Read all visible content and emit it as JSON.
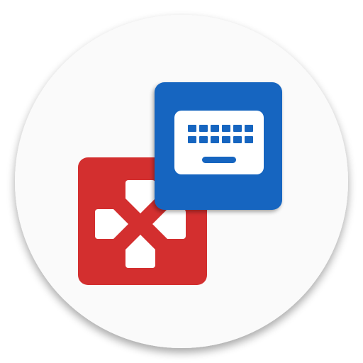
{
  "icon": {
    "name": "gamepad-keyboard-app-icon",
    "background_color": "#fafafa",
    "gamepad_tile_color": "#d32f2f",
    "keyboard_tile_color": "#1565c0",
    "glyph_color": "#ffffff",
    "shapes": [
      "dpad-icon",
      "keyboard-icon"
    ]
  }
}
